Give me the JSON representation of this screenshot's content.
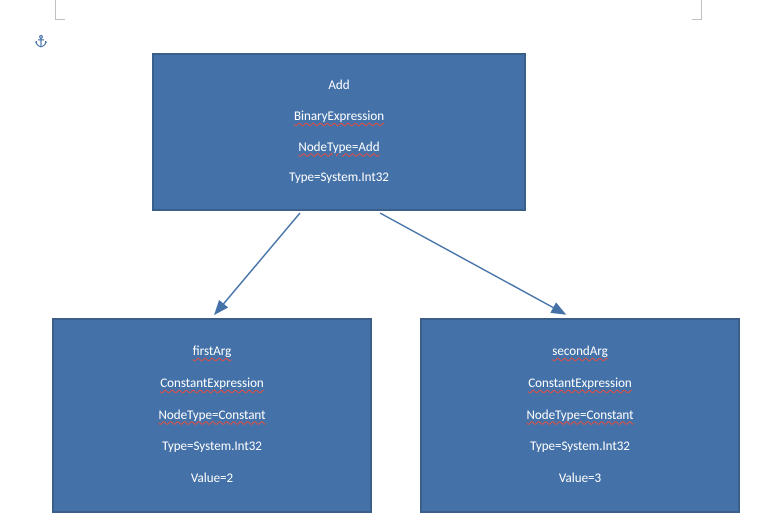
{
  "root": {
    "title": "Add",
    "expr": "BinaryExpression",
    "nodeType": "NodeType=Add",
    "type": "Type=System.Int32"
  },
  "left": {
    "title": "firstArg",
    "expr": "ConstantExpression",
    "nodeType": "NodeType=Constant",
    "type": "Type=System.Int32",
    "value": "Value=2"
  },
  "right": {
    "title": "secondArg",
    "expr": "ConstantExpression",
    "nodeType": "NodeType=Constant",
    "type": "Type=System.Int32",
    "value": "Value=3"
  }
}
